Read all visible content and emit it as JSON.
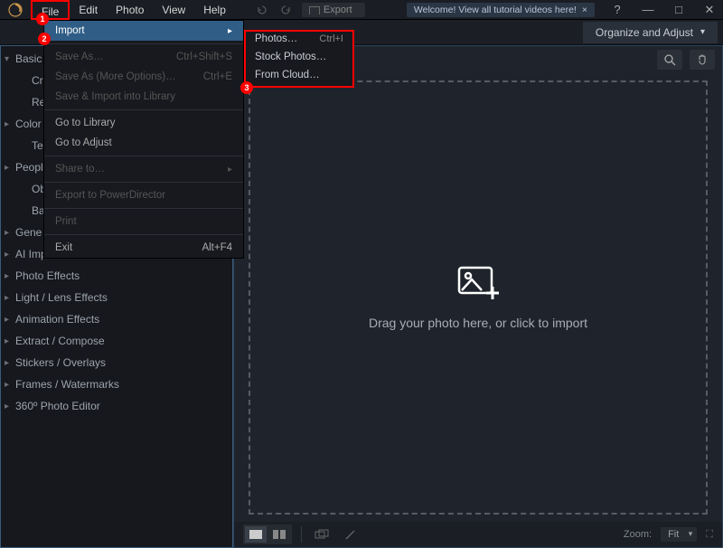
{
  "titlebar": {
    "tutorial_text": "Welcome! View all tutorial videos here!",
    "tutorial_close": "×"
  },
  "menubar": {
    "file": "File",
    "edit": "Edit",
    "photo": "Photo",
    "view": "View",
    "help": "Help"
  },
  "topbar": {
    "export_label": "Export"
  },
  "modebar": {
    "organize_adjust": "Organize and Adjust"
  },
  "sidebar": {
    "items": [
      {
        "label": "Basic",
        "indent": 0,
        "chev": "▾"
      },
      {
        "label": "Crop",
        "indent": 1,
        "chev": ""
      },
      {
        "label": "Resiz",
        "indent": 1,
        "chev": ""
      },
      {
        "label": "Color",
        "indent": 0,
        "chev": "▸"
      },
      {
        "label": "Text e",
        "indent": 1,
        "chev": ""
      },
      {
        "label": "Peopl",
        "indent": 0,
        "chev": "▸"
      },
      {
        "label": "Obje",
        "indent": 1,
        "chev": ""
      },
      {
        "label": "Back",
        "indent": 1,
        "chev": ""
      },
      {
        "label": "Gene",
        "indent": 0,
        "chev": "▸"
      },
      {
        "label": "AI Improvements",
        "indent": 0,
        "chev": "▸"
      },
      {
        "label": "Photo Effects",
        "indent": 0,
        "chev": "▸"
      },
      {
        "label": "Light / Lens Effects",
        "indent": 0,
        "chev": "▸"
      },
      {
        "label": "Animation Effects",
        "indent": 0,
        "chev": "▸"
      },
      {
        "label": "Extract / Compose",
        "indent": 0,
        "chev": "▸"
      },
      {
        "label": "Stickers / Overlays",
        "indent": 0,
        "chev": "▸"
      },
      {
        "label": "Frames / Watermarks",
        "indent": 0,
        "chev": "▸"
      },
      {
        "label": "360º Photo Editor",
        "indent": 0,
        "chev": "▸"
      }
    ]
  },
  "dropdown": {
    "import": "Import",
    "save_as": "Save As…",
    "save_as_sc": "Ctrl+Shift+S",
    "save_as_more": "Save As (More Options)…",
    "save_as_more_sc": "Ctrl+E",
    "save_import_lib": "Save & Import into Library",
    "go_library": "Go to Library",
    "go_adjust": "Go to Adjust",
    "share_to": "Share to…",
    "export_power": "Export to PowerDirector",
    "print": "Print",
    "exit": "Exit",
    "exit_sc": "Alt+F4"
  },
  "submenu": {
    "photos": "Photos…",
    "photos_sc": "Ctrl+I",
    "stock": "Stock Photos…",
    "cloud": "From Cloud…"
  },
  "canvas": {
    "drop_text": "Drag your photo here, or click to import"
  },
  "bottombar": {
    "zoom_label": "Zoom:",
    "zoom_value": "Fit"
  },
  "annotations": {
    "a1": "1",
    "a2": "2",
    "a3": "3"
  }
}
